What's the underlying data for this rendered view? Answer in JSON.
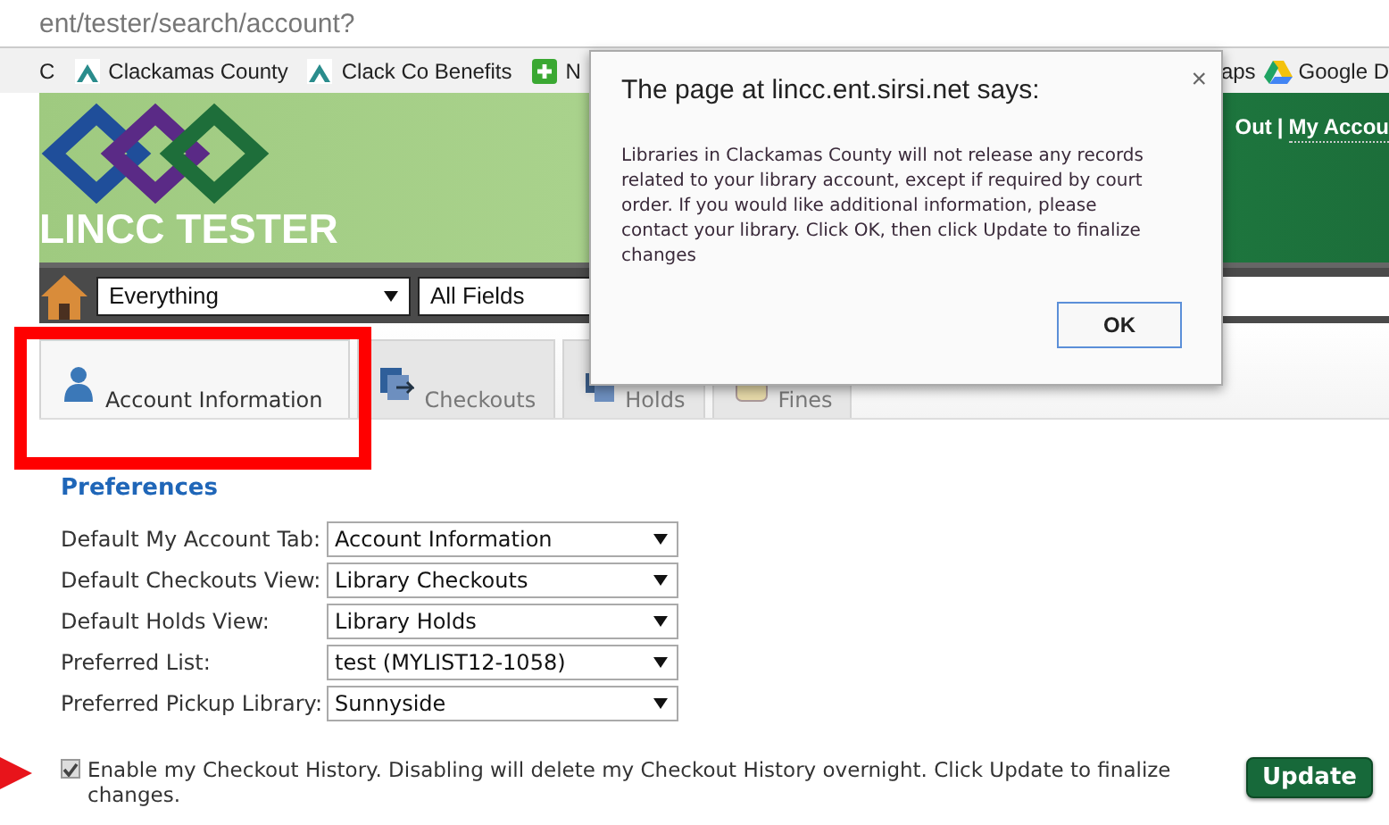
{
  "address_bar": {
    "url": "ent/tester/search/account?"
  },
  "bookmarks": [
    {
      "label": "C",
      "kind": "none"
    },
    {
      "label": "Clackamas County",
      "kind": "mountain"
    },
    {
      "label": "Clack Co Benefits",
      "kind": "mountain"
    },
    {
      "label": "N",
      "kind": "plus"
    },
    {
      "label": "aps",
      "kind": "none"
    },
    {
      "label": "Google D",
      "kind": "drive"
    }
  ],
  "header": {
    "site_title": "LINCC TESTER",
    "links": [
      "Out",
      "My Accou"
    ],
    "separator": "|"
  },
  "search": {
    "scope": "Everything",
    "field": "All Fields"
  },
  "tabs": [
    {
      "label": "Account Information",
      "selected": true
    },
    {
      "label": "Checkouts",
      "selected": false
    },
    {
      "label": "Holds",
      "selected": false
    },
    {
      "label": "Fines",
      "selected": false
    }
  ],
  "preferences": {
    "title": "Preferences",
    "rows": [
      {
        "label": "Default My Account Tab:",
        "value": "Account Information"
      },
      {
        "label": "Default Checkouts View:",
        "value": "Library Checkouts"
      },
      {
        "label": "Default Holds View:",
        "value": "Library Holds"
      },
      {
        "label": "Preferred List:",
        "value": "test (MYLIST12-1058)"
      },
      {
        "label": "Preferred Pickup Library:",
        "value": "Sunnyside"
      }
    ]
  },
  "checkout_history": {
    "checked": true,
    "label": "Enable my Checkout History. Disabling will delete my Checkout History overnight. Click Update to finalize changes."
  },
  "update_button": "Update",
  "dialog": {
    "title": "The page at lincc.ent.sirsi.net says:",
    "close": "×",
    "message": "Libraries in Clackamas County will not release any records related to your library account, except if required by court order. If you would like additional information, please contact your library. Click OK, then click Update to finalize changes",
    "button": "OK"
  }
}
